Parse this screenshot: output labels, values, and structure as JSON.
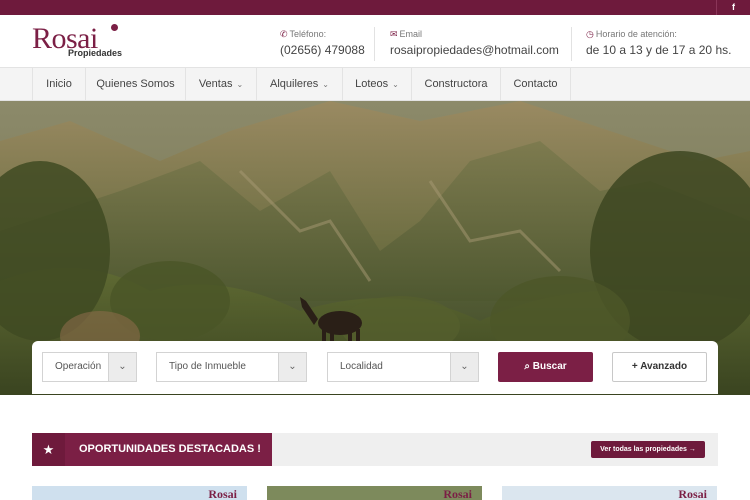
{
  "topbar": {
    "social_icon": "f"
  },
  "logo": {
    "name": "Rosai",
    "tagline": "Propiedades"
  },
  "contact": {
    "phone_label": "Teléfono:",
    "phone_icon": "phone-icon",
    "phone_value": "(02656) 479088",
    "email_label": "Email",
    "email_icon": "envelope-icon",
    "email_value": "rosaipropiedades@hotmail.com",
    "hours_label": "Horario de atención:",
    "hours_icon": "clock-icon",
    "hours_value": "de 10 a 13 y de 17 a 20 hs."
  },
  "nav": {
    "items": [
      {
        "label": "Inicio"
      },
      {
        "label": "Quienes Somos"
      },
      {
        "label": "Ventas",
        "chevron": "⌄"
      },
      {
        "label": "Alquileres",
        "chevron": "⌄"
      },
      {
        "label": "Loteos",
        "chevron": "⌄"
      },
      {
        "label": "Constructora"
      },
      {
        "label": "Contacto"
      }
    ]
  },
  "search": {
    "operacion": "Operación",
    "tipo": "Tipo de Inmueble",
    "localidad": "Localidad",
    "buscar": "Buscar",
    "avanzado": "Avanzado"
  },
  "featured": {
    "title": "OPORTUNIDADES DESTACADAS !",
    "view_all": "Ver todas las propiedades"
  },
  "cards": [
    {
      "watermark": "Rosai"
    },
    {
      "watermark": "Rosai"
    },
    {
      "watermark": "Rosai"
    }
  ],
  "colors": {
    "brand": "#7b1f45",
    "brand_dark": "#6e1a3c"
  }
}
